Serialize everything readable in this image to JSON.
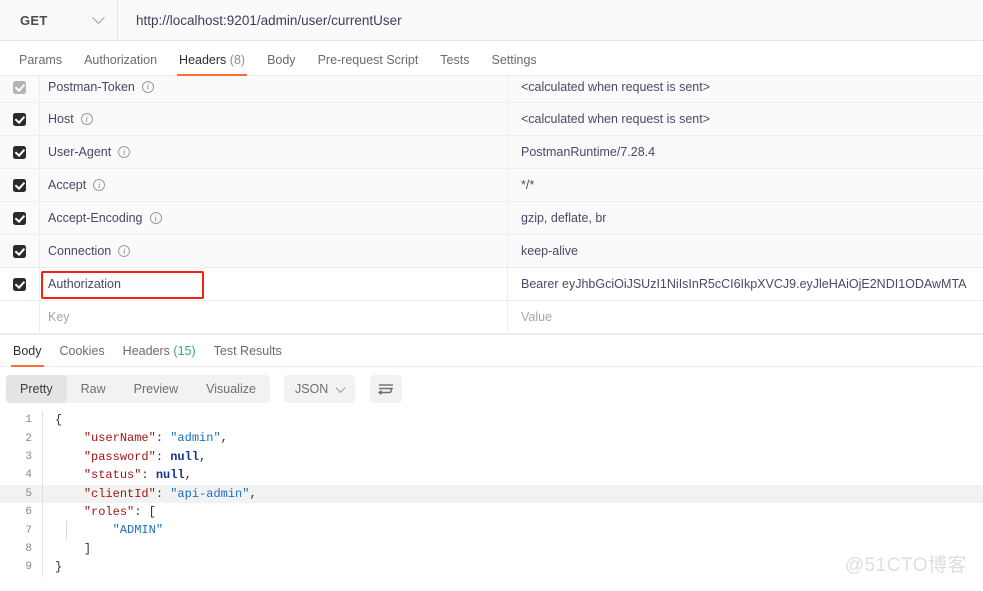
{
  "request_bar": {
    "method": "GET",
    "method_chevron_icon": "chevron-down-icon",
    "url": "http://localhost:9201/admin/user/currentUser"
  },
  "request_tabs": [
    {
      "label": "Params",
      "active": false
    },
    {
      "label": "Authorization",
      "active": false
    },
    {
      "label": "Headers",
      "count": "(8)",
      "active": true
    },
    {
      "label": "Body",
      "active": false
    },
    {
      "label": "Pre-request Script",
      "active": false
    },
    {
      "label": "Tests",
      "active": false
    },
    {
      "label": "Settings",
      "active": false
    }
  ],
  "headers_table": {
    "key_placeholder": "Key",
    "value_placeholder": "Value",
    "info_icon_glyph": "i",
    "rows": [
      {
        "checked": true,
        "disabled": true,
        "key": "Postman-Token",
        "info": true,
        "value": "<calculated when request is sent>"
      },
      {
        "checked": true,
        "disabled": false,
        "key": "Host",
        "info": true,
        "value": "<calculated when request is sent>"
      },
      {
        "checked": true,
        "disabled": false,
        "key": "User-Agent",
        "info": true,
        "value": "PostmanRuntime/7.28.4"
      },
      {
        "checked": true,
        "disabled": false,
        "key": "Accept",
        "info": true,
        "value": "*/*"
      },
      {
        "checked": true,
        "disabled": false,
        "key": "Accept-Encoding",
        "info": true,
        "value": "gzip, deflate, br"
      },
      {
        "checked": true,
        "disabled": false,
        "key": "Connection",
        "info": true,
        "value": "keep-alive"
      },
      {
        "checked": true,
        "disabled": false,
        "key": "Authorization",
        "info": false,
        "value": "Bearer eyJhbGciOiJSUzI1NiIsInR5cCI6IkpXVCJ9.eyJleHAiOjE2NDI1ODAwMTA",
        "highlighted": true
      }
    ]
  },
  "annotation": {
    "color": "#f52018",
    "target": "Authorization"
  },
  "response_tabs": [
    {
      "label": "Body",
      "active": true
    },
    {
      "label": "Cookies",
      "active": false
    },
    {
      "label": "Headers",
      "count": "(15)",
      "active": false
    },
    {
      "label": "Test Results",
      "active": false
    }
  ],
  "view_bar": {
    "modes": [
      {
        "label": "Pretty",
        "active": true
      },
      {
        "label": "Raw",
        "active": false
      },
      {
        "label": "Preview",
        "active": false
      },
      {
        "label": "Visualize",
        "active": false
      }
    ],
    "format": "JSON",
    "format_chevron_icon": "chevron-down-icon",
    "wrap_button_icon": "wrap-lines-icon"
  },
  "response_body": {
    "language": "json",
    "highlighted_line": 5,
    "lines": [
      {
        "n": "1",
        "segments": [
          {
            "t": "{",
            "c": "pun"
          }
        ]
      },
      {
        "n": "2",
        "segments": [
          {
            "t": "    ",
            "c": "pun"
          },
          {
            "t": "\"userName\"",
            "c": "key"
          },
          {
            "t": ": ",
            "c": "pun"
          },
          {
            "t": "\"admin\"",
            "c": "str"
          },
          {
            "t": ",",
            "c": "pun"
          }
        ]
      },
      {
        "n": "3",
        "segments": [
          {
            "t": "    ",
            "c": "pun"
          },
          {
            "t": "\"password\"",
            "c": "key"
          },
          {
            "t": ": ",
            "c": "pun"
          },
          {
            "t": "null",
            "c": "null"
          },
          {
            "t": ",",
            "c": "pun"
          }
        ]
      },
      {
        "n": "4",
        "segments": [
          {
            "t": "    ",
            "c": "pun"
          },
          {
            "t": "\"status\"",
            "c": "key"
          },
          {
            "t": ": ",
            "c": "pun"
          },
          {
            "t": "null",
            "c": "null"
          },
          {
            "t": ",",
            "c": "pun"
          }
        ]
      },
      {
        "n": "5",
        "segments": [
          {
            "t": "    ",
            "c": "pun"
          },
          {
            "t": "\"clientId\"",
            "c": "key"
          },
          {
            "t": ": ",
            "c": "pun"
          },
          {
            "t": "\"api-admin\"",
            "c": "str"
          },
          {
            "t": ",",
            "c": "pun"
          }
        ]
      },
      {
        "n": "6",
        "segments": [
          {
            "t": "    ",
            "c": "pun"
          },
          {
            "t": "\"roles\"",
            "c": "key"
          },
          {
            "t": ": ",
            "c": "pun"
          },
          {
            "t": "[",
            "c": "pun"
          }
        ]
      },
      {
        "n": "7",
        "segments": [
          {
            "t": "        ",
            "c": "pun"
          },
          {
            "t": "\"ADMIN\"",
            "c": "str"
          }
        ]
      },
      {
        "n": "8",
        "segments": [
          {
            "t": "    ",
            "c": "pun"
          },
          {
            "t": "]",
            "c": "pun"
          }
        ]
      },
      {
        "n": "9",
        "segments": [
          {
            "t": "}",
            "c": "pun"
          }
        ]
      }
    ]
  },
  "watermark": "@51CTO博客"
}
